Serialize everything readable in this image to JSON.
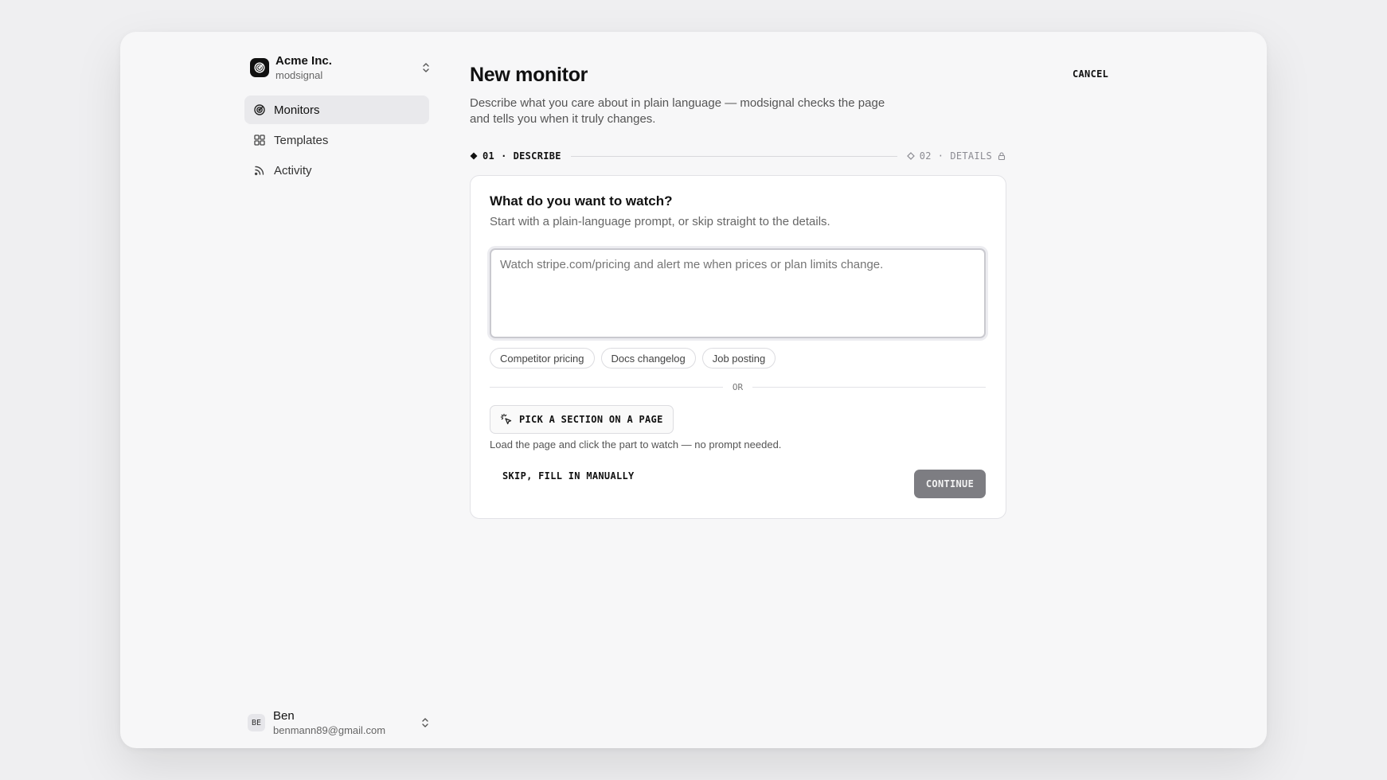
{
  "org": {
    "name": "Acme Inc.",
    "subtitle": "modsignal",
    "switch_icon": "chevron-up-down-icon"
  },
  "nav": {
    "items": [
      {
        "label": "Monitors",
        "icon": "radar-icon",
        "active": true
      },
      {
        "label": "Templates",
        "icon": "grid-icon",
        "active": false
      },
      {
        "label": "Activity",
        "icon": "rss-icon",
        "active": false
      }
    ]
  },
  "user": {
    "initials": "BE",
    "name": "Ben",
    "email": "benmann89@gmail.com"
  },
  "header": {
    "title": "New monitor",
    "cancel_label": "CANCEL",
    "description": "Describe what you care about in plain language — modsignal checks the page and tells you when it truly changes."
  },
  "steps": {
    "step1": {
      "number": "01",
      "label": "DESCRIBE",
      "state": "current"
    },
    "step2": {
      "number": "02",
      "label": "DETAILS",
      "state": "locked"
    },
    "separator": "·"
  },
  "card": {
    "title": "What do you want to watch?",
    "subtitle": "Start with a plain-language prompt, or skip straight to the details.",
    "prompt_placeholder": "Watch stripe.com/pricing and alert me when prices or plan limits change.",
    "prompt_value": "",
    "chips": [
      "Competitor pricing",
      "Docs changelog",
      "Job posting"
    ],
    "or_label": "OR",
    "pick_label": "PICK A SECTION ON A PAGE",
    "pick_help": "Load the page and click the part to watch — no prompt needed.",
    "skip_label": "SKIP, FILL IN MANUALLY",
    "continue_label": "CONTINUE"
  },
  "colors": {
    "accent": "#111111",
    "continue_bg": "#7d7d82",
    "page_bg": "#f7f7f8"
  }
}
